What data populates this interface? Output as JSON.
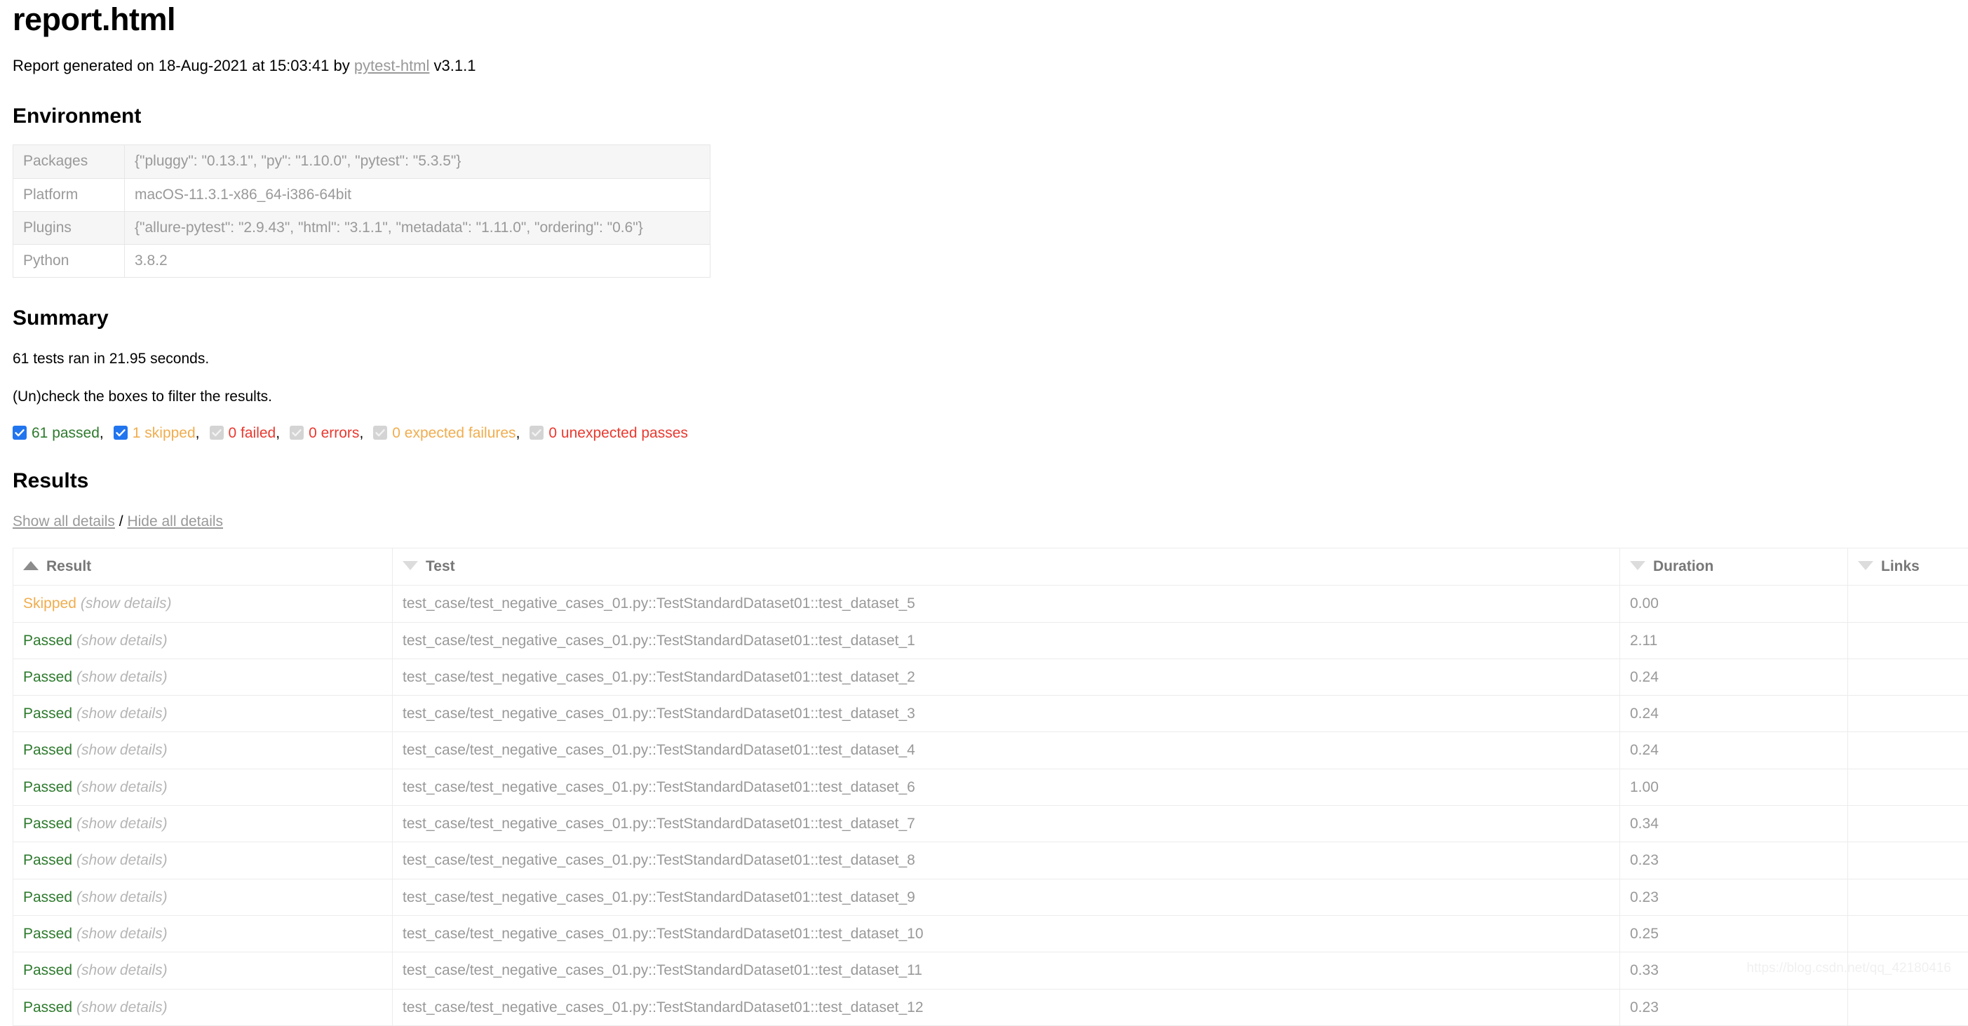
{
  "header": {
    "title": "report.html",
    "generated_prefix": "Report generated on 18-Aug-2021 at 15:03:41 by ",
    "generator_link": "pytest-html",
    "generator_version": " v3.1.1"
  },
  "environment": {
    "heading": "Environment",
    "rows": [
      {
        "key": "Packages",
        "value": "{\"pluggy\": \"0.13.1\", \"py\": \"1.10.0\", \"pytest\": \"5.3.5\"}"
      },
      {
        "key": "Platform",
        "value": "macOS-11.3.1-x86_64-i386-64bit"
      },
      {
        "key": "Plugins",
        "value": "{\"allure-pytest\": \"2.9.43\", \"html\": \"3.1.1\", \"metadata\": \"1.11.0\", \"ordering\": \"0.6\"}"
      },
      {
        "key": "Python",
        "value": "3.8.2"
      }
    ]
  },
  "summary": {
    "heading": "Summary",
    "run_line": "61 tests ran in 21.95 seconds.",
    "filter_hint": "(Un)check the boxes to filter the results.",
    "filters": [
      {
        "label": "61 passed",
        "checked": true,
        "color_class": "c-passed",
        "trailing": ","
      },
      {
        "label": "1 skipped",
        "checked": true,
        "color_class": "c-skipped",
        "trailing": ","
      },
      {
        "label": "0 failed",
        "checked": false,
        "color_class": "c-failed",
        "trailing": ","
      },
      {
        "label": "0 errors",
        "checked": false,
        "color_class": "c-errors",
        "trailing": ","
      },
      {
        "label": "0 expected failures",
        "checked": false,
        "color_class": "c-xfailed",
        "trailing": ","
      },
      {
        "label": "0 unexpected passes",
        "checked": false,
        "color_class": "c-xpassed",
        "trailing": ""
      }
    ]
  },
  "results": {
    "heading": "Results",
    "show_all": "Show all details",
    "separator": "/",
    "hide_all": "Hide all details",
    "columns": [
      {
        "label": "Result",
        "sort": "asc"
      },
      {
        "label": "Test",
        "sort": "none"
      },
      {
        "label": "Duration",
        "sort": "none"
      },
      {
        "label": "Links",
        "sort": "none"
      }
    ],
    "show_details_label": "(show details)",
    "rows": [
      {
        "result": "Skipped",
        "result_class": "res-skipped",
        "test": "test_case/test_negative_cases_01.py::TestStandardDataset01::test_dataset_5",
        "duration": "0.00",
        "links": ""
      },
      {
        "result": "Passed",
        "result_class": "res-passed",
        "test": "test_case/test_negative_cases_01.py::TestStandardDataset01::test_dataset_1",
        "duration": "2.11",
        "links": ""
      },
      {
        "result": "Passed",
        "result_class": "res-passed",
        "test": "test_case/test_negative_cases_01.py::TestStandardDataset01::test_dataset_2",
        "duration": "0.24",
        "links": ""
      },
      {
        "result": "Passed",
        "result_class": "res-passed",
        "test": "test_case/test_negative_cases_01.py::TestStandardDataset01::test_dataset_3",
        "duration": "0.24",
        "links": ""
      },
      {
        "result": "Passed",
        "result_class": "res-passed",
        "test": "test_case/test_negative_cases_01.py::TestStandardDataset01::test_dataset_4",
        "duration": "0.24",
        "links": ""
      },
      {
        "result": "Passed",
        "result_class": "res-passed",
        "test": "test_case/test_negative_cases_01.py::TestStandardDataset01::test_dataset_6",
        "duration": "1.00",
        "links": ""
      },
      {
        "result": "Passed",
        "result_class": "res-passed",
        "test": "test_case/test_negative_cases_01.py::TestStandardDataset01::test_dataset_7",
        "duration": "0.34",
        "links": ""
      },
      {
        "result": "Passed",
        "result_class": "res-passed",
        "test": "test_case/test_negative_cases_01.py::TestStandardDataset01::test_dataset_8",
        "duration": "0.23",
        "links": ""
      },
      {
        "result": "Passed",
        "result_class": "res-passed",
        "test": "test_case/test_negative_cases_01.py::TestStandardDataset01::test_dataset_9",
        "duration": "0.23",
        "links": ""
      },
      {
        "result": "Passed",
        "result_class": "res-passed",
        "test": "test_case/test_negative_cases_01.py::TestStandardDataset01::test_dataset_10",
        "duration": "0.25",
        "links": ""
      },
      {
        "result": "Passed",
        "result_class": "res-passed",
        "test": "test_case/test_negative_cases_01.py::TestStandardDataset01::test_dataset_11",
        "duration": "0.33",
        "links": ""
      },
      {
        "result": "Passed",
        "result_class": "res-passed",
        "test": "test_case/test_negative_cases_01.py::TestStandardDataset01::test_dataset_12",
        "duration": "0.23",
        "links": ""
      }
    ]
  },
  "watermark": "https://blog.csdn.net/qq_42180416"
}
